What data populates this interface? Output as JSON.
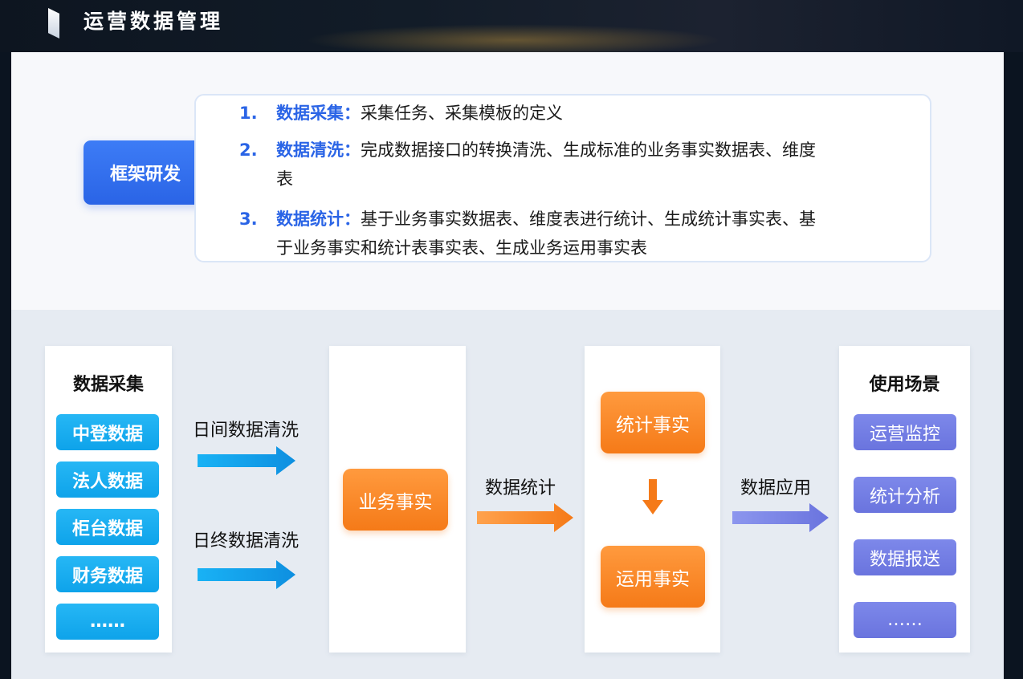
{
  "header": {
    "title": "运营数据管理"
  },
  "framework": {
    "label": "框架研发",
    "items": [
      {
        "num": "1.",
        "keyword": "数据采集：",
        "lines": [
          "采集任务、采集模板的定义"
        ]
      },
      {
        "num": "2.",
        "keyword": "数据清洗：",
        "lines": [
          "完成数据接口的转换清洗、生成标准的业务事实数据表、维度",
          "表"
        ]
      },
      {
        "num": "3.",
        "keyword": "数据统计：",
        "lines": [
          "基于业务事实数据表、维度表进行统计、生成统计事实表、基",
          "于业务事实和统计表事实表、生成业务运用事实表"
        ]
      }
    ]
  },
  "flow": {
    "collect": {
      "title": "数据采集",
      "sources": [
        "中登数据",
        "法人数据",
        "柜台数据",
        "财务数据",
        "……"
      ]
    },
    "clean_labels": [
      "日间数据清洗",
      "日终数据清洗"
    ],
    "business_fact": "业务事实",
    "stat_label": "数据统计",
    "stat_fact": "统计事实",
    "apply_fact": "运用事实",
    "apply_label": "数据应用",
    "usage": {
      "title": "使用场景",
      "items": [
        "运营监控",
        "统计分析",
        "数据报送",
        "……"
      ]
    }
  },
  "colors": {
    "primary_blue": "#2a64e6",
    "source_cyan": "#0ea3ea",
    "fact_orange": "#f57a18",
    "usage_purple": "#6a74de"
  }
}
